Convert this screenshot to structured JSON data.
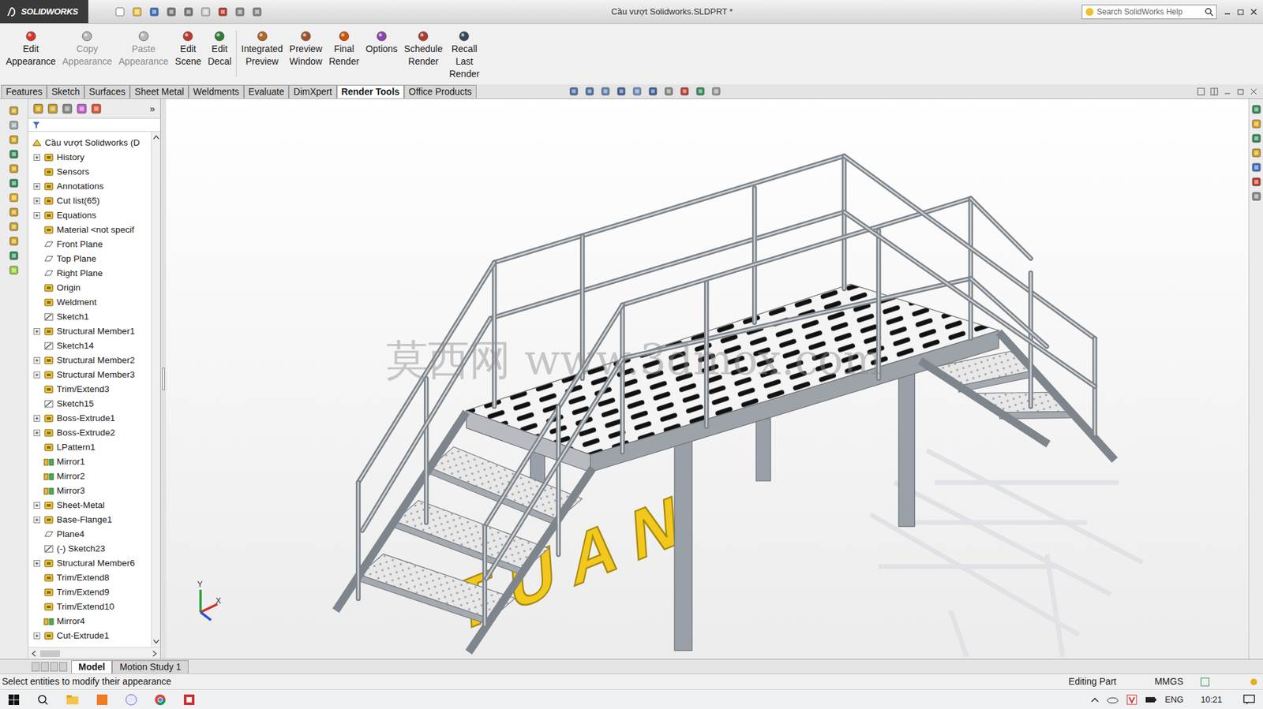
{
  "window": {
    "app": "SOLIDWORKS",
    "title": "Cầu vượt Solidworks.SLDPRT *",
    "search_placeholder": "Search SolidWorks Help"
  },
  "ribbon": [
    {
      "lines": [
        "Edit",
        "Appearance"
      ],
      "disabled": false
    },
    {
      "lines": [
        "Copy",
        "Appearance"
      ],
      "disabled": true
    },
    {
      "lines": [
        "Paste",
        "Appearance"
      ],
      "disabled": true
    },
    {
      "lines": [
        "Edit",
        "Scene"
      ],
      "disabled": false
    },
    {
      "lines": [
        "Edit",
        "Decal"
      ],
      "disabled": false
    },
    {
      "lines": [
        "Integrated",
        "Preview"
      ],
      "disabled": false
    },
    {
      "lines": [
        "Preview",
        "Window"
      ],
      "disabled": false
    },
    {
      "lines": [
        "Final",
        "Render"
      ],
      "disabled": false
    },
    {
      "lines": [
        "Options"
      ],
      "disabled": false
    },
    {
      "lines": [
        "Schedule",
        "Render"
      ],
      "disabled": false
    },
    {
      "lines": [
        "Recall",
        "Last",
        "Render"
      ],
      "disabled": false
    }
  ],
  "tabs": [
    {
      "label": "Features",
      "selected": false
    },
    {
      "label": "Sketch",
      "selected": false
    },
    {
      "label": "Surfaces",
      "selected": false
    },
    {
      "label": "Sheet Metal",
      "selected": false
    },
    {
      "label": "Weldments",
      "selected": false
    },
    {
      "label": "Evaluate",
      "selected": false
    },
    {
      "label": "DimXpert",
      "selected": false
    },
    {
      "label": "Render Tools",
      "selected": true
    },
    {
      "label": "Office Products",
      "selected": false
    }
  ],
  "feature_tree": {
    "collapse_button": "»",
    "root": "Cầu vượt Solidworks (D",
    "items": [
      {
        "label": "History",
        "expandable": true
      },
      {
        "label": "Sensors",
        "expandable": false
      },
      {
        "label": "Annotations",
        "expandable": true
      },
      {
        "label": "Cut list(65)",
        "expandable": true
      },
      {
        "label": "Equations",
        "expandable": true
      },
      {
        "label": "Material <not specif",
        "expandable": false
      },
      {
        "label": "Front Plane",
        "expandable": false
      },
      {
        "label": "Top Plane",
        "expandable": false
      },
      {
        "label": "Right Plane",
        "expandable": false
      },
      {
        "label": "Origin",
        "expandable": false
      },
      {
        "label": "Weldment",
        "expandable": false
      },
      {
        "label": "Sketch1",
        "expandable": false
      },
      {
        "label": "Structural Member1",
        "expandable": true
      },
      {
        "label": "Sketch14",
        "expandable": false
      },
      {
        "label": "Structural Member2",
        "expandable": true
      },
      {
        "label": "Structural Member3",
        "expandable": true
      },
      {
        "label": "Trim/Extend3",
        "expandable": false
      },
      {
        "label": "Sketch15",
        "expandable": false
      },
      {
        "label": "Boss-Extrude1",
        "expandable": true
      },
      {
        "label": "Boss-Extrude2",
        "expandable": true
      },
      {
        "label": "LPattern1",
        "expandable": false
      },
      {
        "label": "Mirror1",
        "expandable": false
      },
      {
        "label": "Mirror2",
        "expandable": false
      },
      {
        "label": "Mirror3",
        "expandable": false
      },
      {
        "label": "Sheet-Metal",
        "expandable": true
      },
      {
        "label": "Base-Flange1",
        "expandable": true
      },
      {
        "label": "Plane4",
        "expandable": false
      },
      {
        "label": "(-) Sketch23",
        "expandable": false
      },
      {
        "label": "Structural Member6",
        "expandable": true
      },
      {
        "label": "Trim/Extend8",
        "expandable": false
      },
      {
        "label": "Trim/Extend9",
        "expandable": false
      },
      {
        "label": "Trim/Extend10",
        "expandable": false
      },
      {
        "label": "Mirror4",
        "expandable": false
      },
      {
        "label": "Cut-Extrude1",
        "expandable": true
      }
    ]
  },
  "viewport": {
    "watermark": "莫西网 www.3dmox.com",
    "model_text": "TUAN",
    "triad_labels": [
      "Y",
      "X"
    ]
  },
  "bottom_tabs": [
    {
      "label": "Model",
      "selected": true
    },
    {
      "label": "Motion Study 1",
      "selected": false
    }
  ],
  "status_bar": {
    "message": "Select entities to modify their appearance",
    "mode": "Editing Part",
    "units": "MMGS"
  },
  "taskbar": {
    "language": "ENG",
    "time": "10:21"
  }
}
